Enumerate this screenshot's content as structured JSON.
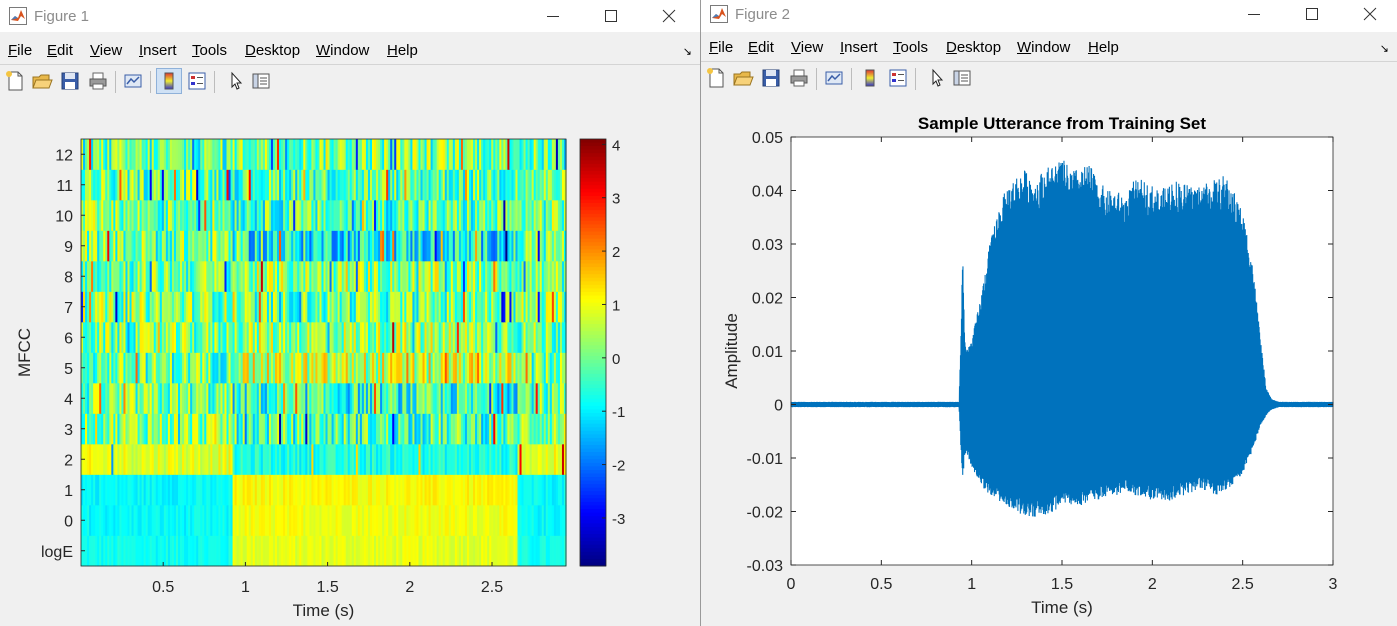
{
  "menu_items": [
    "File",
    "Edit",
    "View",
    "Insert",
    "Tools",
    "Desktop",
    "Window",
    "Help"
  ],
  "figure1": {
    "window_title": "Figure 1",
    "y_ticks": [
      "12",
      "11",
      "10",
      "9",
      "8",
      "7",
      "6",
      "5",
      "4",
      "3",
      "2",
      "1",
      "0",
      "logE"
    ],
    "x_ticks": [
      "0.5",
      "1",
      "1.5",
      "2",
      "2.5"
    ],
    "xlabel": "Time (s)",
    "ylabel": "MFCC",
    "colorbar_ticks": [
      "4",
      "3",
      "2",
      "1",
      "0",
      "-1",
      "-2",
      "-3"
    ],
    "chart_data": {
      "type": "heatmap",
      "title": "",
      "xlabel": "Time (s)",
      "ylabel": "MFCC",
      "xlim": [
        0,
        2.95
      ],
      "rows": [
        "logE",
        "0",
        "1",
        "2",
        "3",
        "4",
        "5",
        "6",
        "7",
        "8",
        "9",
        "10",
        "11",
        "12"
      ],
      "colormap": "jet",
      "color_range": [
        -3.9,
        4.1
      ],
      "colorbar_ticks": [
        -3,
        -2,
        -1,
        0,
        1,
        2,
        3,
        4
      ],
      "speech_interval_s": [
        0.92,
        2.65
      ],
      "row_levels_silence": [
        -0.8,
        -0.9,
        -0.9,
        0.9,
        0.2,
        -0.1,
        -0.1,
        0.0,
        0.1,
        0.0,
        0.0,
        0.0,
        -0.1,
        -0.2
      ],
      "row_levels_speech": [
        0.9,
        1.0,
        1.1,
        -0.7,
        -0.3,
        -0.6,
        0.6,
        0.3,
        -0.1,
        0.2,
        -0.9,
        -0.3,
        -0.2,
        0.1
      ]
    }
  },
  "figure2": {
    "window_title": "Figure 2",
    "title": "Sample Utterance from Training Set",
    "xlabel": "Time (s)",
    "ylabel": "Amplitude",
    "x_ticks": [
      "0",
      "0.5",
      "1",
      "1.5",
      "2",
      "2.5",
      "3"
    ],
    "y_ticks": [
      "0.05",
      "0.04",
      "0.03",
      "0.02",
      "0.01",
      "0",
      "-0.01",
      "-0.02",
      "-0.03"
    ],
    "chart_data": {
      "type": "line",
      "title": "Sample Utterance from Training Set",
      "xlabel": "Time (s)",
      "ylabel": "Amplitude",
      "xlim": [
        0,
        3
      ],
      "ylim": [
        -0.03,
        0.05
      ],
      "series_color": "#0072bd",
      "envelope_t": [
        0,
        0.93,
        0.94,
        0.95,
        0.96,
        0.97,
        1.0,
        1.05,
        1.1,
        1.15,
        1.2,
        1.25,
        1.3,
        1.35,
        1.4,
        1.45,
        1.5,
        1.55,
        1.6,
        1.65,
        1.7,
        1.75,
        1.8,
        1.85,
        1.9,
        1.95,
        2.0,
        2.05,
        2.1,
        2.15,
        2.2,
        2.25,
        2.3,
        2.35,
        2.4,
        2.45,
        2.5,
        2.55,
        2.6,
        2.63,
        2.66,
        2.7,
        3.0
      ],
      "envelope_upper": [
        0.0005,
        0.0005,
        0.012,
        0.03,
        0.014,
        0.01,
        0.012,
        0.02,
        0.03,
        0.037,
        0.041,
        0.043,
        0.044,
        0.042,
        0.044,
        0.045,
        0.046,
        0.044,
        0.044,
        0.045,
        0.042,
        0.04,
        0.04,
        0.039,
        0.042,
        0.042,
        0.041,
        0.04,
        0.042,
        0.042,
        0.041,
        0.041,
        0.042,
        0.042,
        0.043,
        0.04,
        0.036,
        0.028,
        0.012,
        0.003,
        0.001,
        0.0005,
        0.0005
      ],
      "envelope_lower": [
        -0.0005,
        -0.0005,
        -0.008,
        -0.015,
        -0.01,
        -0.009,
        -0.012,
        -0.015,
        -0.017,
        -0.018,
        -0.019,
        -0.02,
        -0.021,
        -0.021,
        -0.021,
        -0.02,
        -0.019,
        -0.019,
        -0.019,
        -0.018,
        -0.018,
        -0.017,
        -0.017,
        -0.016,
        -0.017,
        -0.017,
        -0.018,
        -0.018,
        -0.018,
        -0.017,
        -0.017,
        -0.016,
        -0.016,
        -0.017,
        -0.016,
        -0.015,
        -0.013,
        -0.009,
        -0.004,
        -0.002,
        -0.001,
        -0.0005,
        -0.0005
      ]
    }
  }
}
